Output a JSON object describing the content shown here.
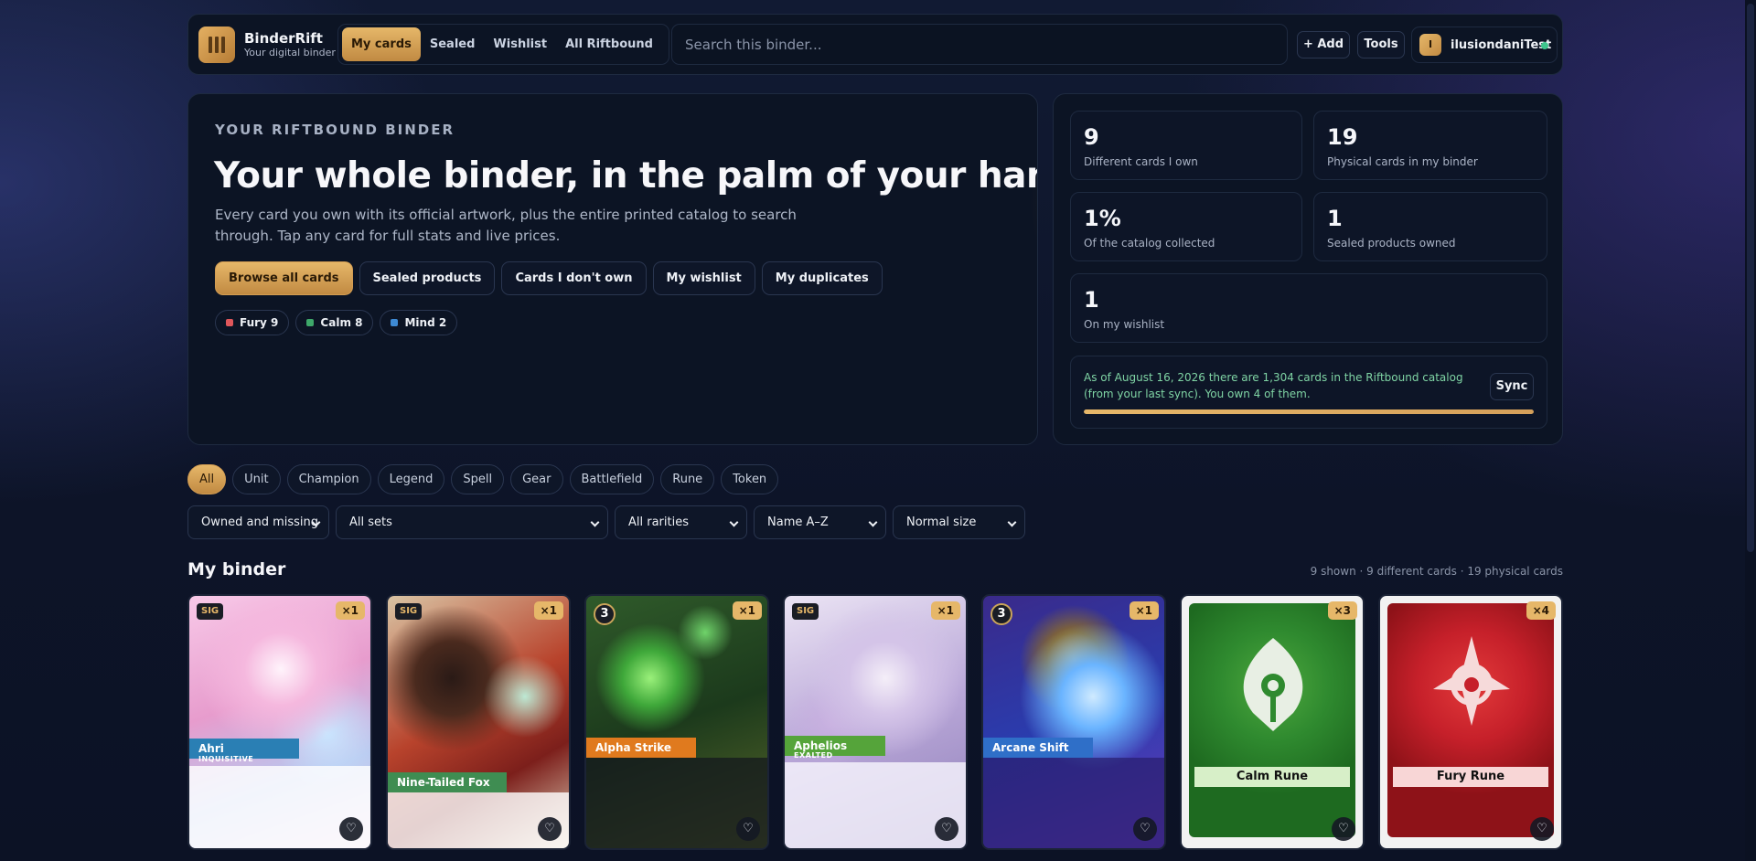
{
  "brand": {
    "name": "BinderRift",
    "tagline": "Your digital binder"
  },
  "nav": {
    "tabs": [
      {
        "label": "My cards",
        "active": true
      },
      {
        "label": "Sealed",
        "active": false
      },
      {
        "label": "Wishlist",
        "active": false
      },
      {
        "label": "All Riftbound",
        "active": false
      }
    ],
    "search_placeholder": "Search this binder...",
    "add_label": "+ Add",
    "tools_label": "Tools",
    "user": {
      "initial": "I",
      "name": "ilusiondaniTest",
      "status_color": "#3ec58d"
    }
  },
  "hero": {
    "eyebrow": "YOUR RIFTBOUND BINDER",
    "title": "Your whole binder, in the palm of your hand.",
    "description": "Every card you own with its official artwork, plus the entire printed catalog to search through. Tap any card for full stats and live prices.",
    "actions": [
      "Browse all cards",
      "Sealed products",
      "Cards I don't own",
      "My wishlist",
      "My duplicates"
    ],
    "domains": [
      {
        "label": "Fury 9",
        "color": "#e0575b"
      },
      {
        "label": "Calm 8",
        "color": "#3ea86a"
      },
      {
        "label": "Mind 2",
        "color": "#3e8ad4"
      }
    ]
  },
  "stats": {
    "items": [
      {
        "value": "9",
        "label": "Different cards I own"
      },
      {
        "value": "19",
        "label": "Physical cards in my binder"
      },
      {
        "value": "1%",
        "label": "Of the catalog collected"
      },
      {
        "value": "1",
        "label": "Sealed products owned"
      },
      {
        "value": "1",
        "label": "On my wishlist"
      }
    ],
    "sync_text": "As of August 16, 2026 there are 1,304 cards in the Riftbound catalog (from your last sync). You own 4 of them.",
    "sync_label": "Sync",
    "sync_progress": 1.0
  },
  "filters": {
    "types": [
      {
        "label": "All",
        "active": true
      },
      {
        "label": "Unit",
        "active": false
      },
      {
        "label": "Champion",
        "active": false
      },
      {
        "label": "Legend",
        "active": false
      },
      {
        "label": "Spell",
        "active": false
      },
      {
        "label": "Gear",
        "active": false
      },
      {
        "label": "Battlefield",
        "active": false
      },
      {
        "label": "Rune",
        "active": false
      },
      {
        "label": "Token",
        "active": false
      }
    ],
    "selects": [
      "Owned and missing",
      "All sets",
      "All rarities",
      "Name A–Z",
      "Normal size"
    ]
  },
  "binder": {
    "title": "My binder",
    "meta": "9 shown · 9 different cards · 19 physical cards"
  },
  "cards": [
    {
      "name": "Ahri",
      "sub": "INQUISITIVE",
      "count": "×1",
      "tag": "SIG",
      "accent": "#2a7fb4"
    },
    {
      "name": "Nine-Tailed Fox",
      "sub": "",
      "count": "×1",
      "tag": "SIG",
      "accent": "#3f8d52"
    },
    {
      "name": "Alpha Strike",
      "sub": "",
      "count": "×1",
      "tag": "3",
      "accent": "#e07a1e"
    },
    {
      "name": "Aphelios",
      "sub": "EXALTED",
      "count": "×1",
      "tag": "SIG",
      "accent": "#55a43a"
    },
    {
      "name": "Arcane Shift",
      "sub": "",
      "count": "×1",
      "tag": "3",
      "accent": "#2f6fc8"
    },
    {
      "name": "Calm Rune",
      "sub": "",
      "count": "×3",
      "tag": "",
      "accent": "#2f8a2f"
    },
    {
      "name": "Fury Rune",
      "sub": "",
      "count": "×4",
      "tag": "",
      "accent": "#c6202a"
    }
  ]
}
